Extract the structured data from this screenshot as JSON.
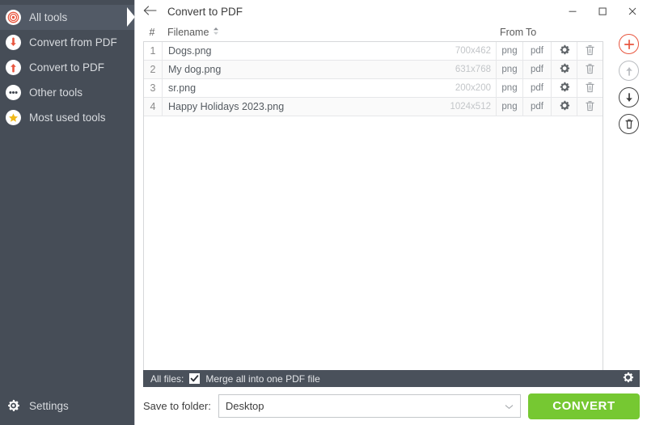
{
  "sidebar": {
    "items": [
      {
        "label": "All tools",
        "icon": "target-icon",
        "active": true
      },
      {
        "label": "Convert from PDF",
        "icon": "arrow-down-icon",
        "active": false
      },
      {
        "label": "Convert to PDF",
        "icon": "arrow-up-icon",
        "active": false
      },
      {
        "label": "Other tools",
        "icon": "ellipsis-icon",
        "active": false
      },
      {
        "label": "Most used tools",
        "icon": "star-icon",
        "active": false
      }
    ],
    "settings": {
      "label": "Settings",
      "icon": "gear-icon"
    },
    "background_color": "#464d57"
  },
  "titlebar": {
    "back_icon": "arrow-left-icon",
    "title": "Convert to PDF",
    "minimize_label": "–",
    "maximize_label": "☐",
    "close_label": "✕"
  },
  "table": {
    "headers": {
      "num": "#",
      "filename": "Filename",
      "sort_icon": "sort-icon",
      "from": "From",
      "to": "To"
    },
    "rows": [
      {
        "num": "1",
        "filename": "Dogs.png",
        "dimensions": "700x462",
        "from": "png",
        "to": "pdf"
      },
      {
        "num": "2",
        "filename": "My dog.png",
        "dimensions": "631x768",
        "from": "png",
        "to": "pdf"
      },
      {
        "num": "3",
        "filename": "sr.png",
        "dimensions": "200x200",
        "from": "png",
        "to": "pdf"
      },
      {
        "num": "4",
        "filename": "Happy Holidays 2023.png",
        "dimensions": "1024x512",
        "from": "png",
        "to": "pdf"
      }
    ],
    "row_settings_icon": "gear-icon",
    "row_delete_icon": "trash-icon"
  },
  "rail": {
    "add": {
      "icon": "plus-circle-icon",
      "color": "#e8563f",
      "enabled": true
    },
    "move_up": {
      "icon": "arrow-up-circle-icon",
      "color": "#b9bcc0",
      "enabled": false
    },
    "move_down": {
      "icon": "arrow-down-circle-icon",
      "color": "#444444",
      "enabled": true
    },
    "delete_all": {
      "icon": "trash-circle-icon",
      "color": "#444444",
      "enabled": true
    }
  },
  "mergebar": {
    "all_files_label": "All files:",
    "checkbox_checked": true,
    "merge_label": "Merge all into one PDF file",
    "settings_icon": "gear-icon",
    "background_color": "#4a515b"
  },
  "savebar": {
    "save_label": "Save to folder:",
    "folder_value": "Desktop",
    "caret_icon": "chevron-down-icon",
    "convert_label": "CONVERT",
    "convert_color": "#76c832"
  }
}
